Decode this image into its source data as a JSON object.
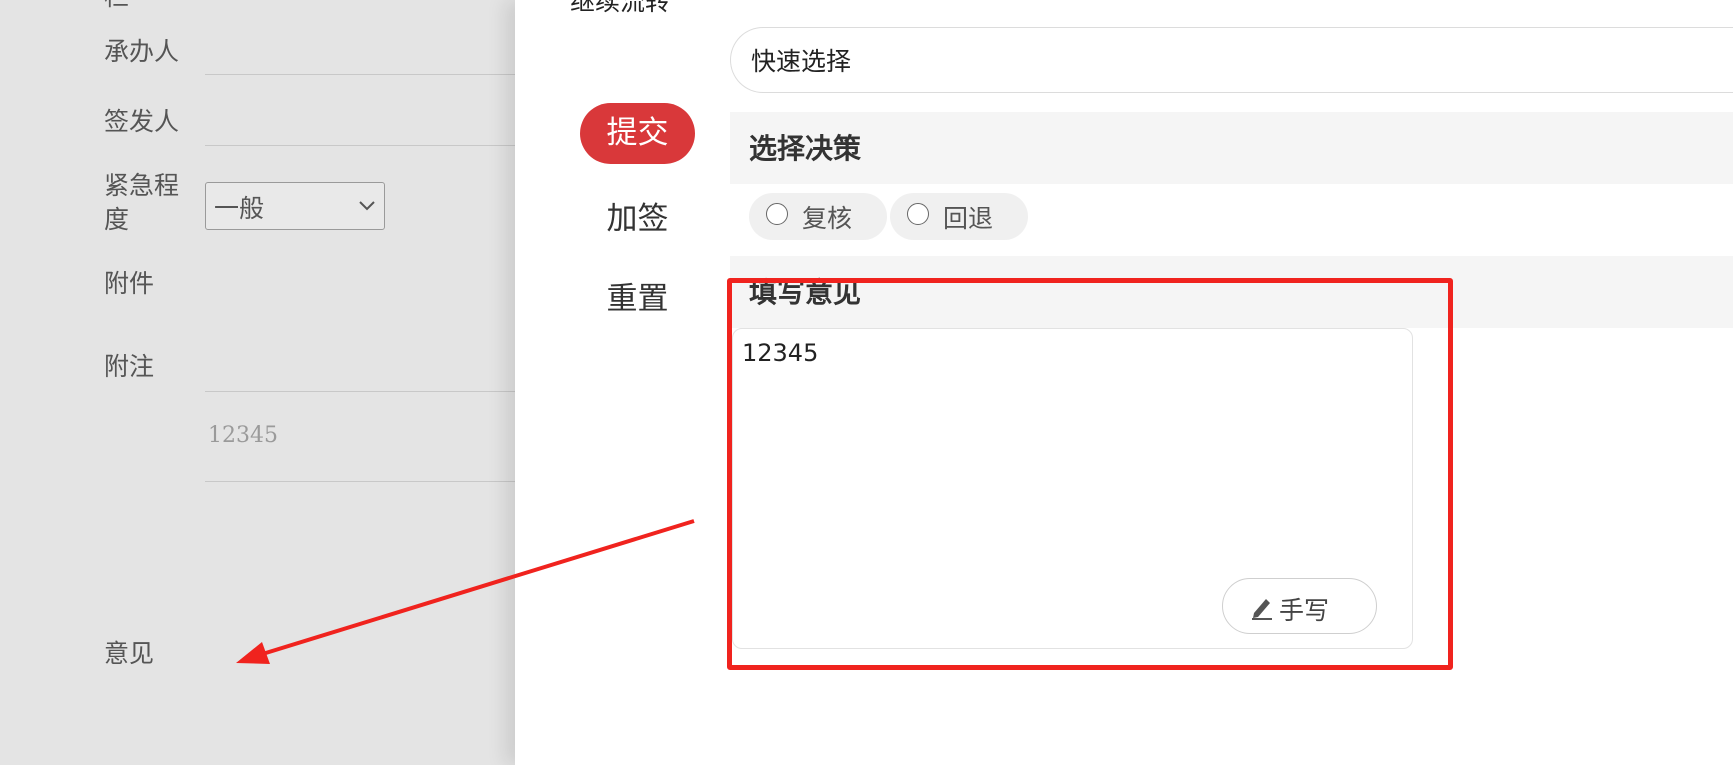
{
  "left_form": {
    "fields": {
      "handler_label": "承办人",
      "signer_label": "签发人",
      "urgency_label_line1": "紧急程",
      "urgency_label_line2": "度",
      "urgency_value": "一般",
      "attachment_label": "附件",
      "note_label": "附注",
      "note_value": "12345",
      "opinion_label": "意见"
    }
  },
  "panel": {
    "title_partial": "继续流转",
    "quick_select": "快速选择",
    "actions": {
      "submit": "提交",
      "add_sign": "加签",
      "reset": "重置"
    },
    "decision": {
      "heading": "选择决策",
      "options": [
        "复核",
        "回退"
      ]
    },
    "opinion": {
      "heading": "填写意见",
      "value": "12345",
      "handwrite_label": "手写"
    }
  },
  "colors": {
    "submit_bg": "#d9383a",
    "annotation_red": "#f0231e",
    "panel_bg": "#ffffff",
    "overlay_bg": "#e4e4e4"
  },
  "icons": {
    "select_caret": "chevron-down-icon",
    "handwrite": "pen-icon",
    "annotation": "arrow-icon"
  }
}
